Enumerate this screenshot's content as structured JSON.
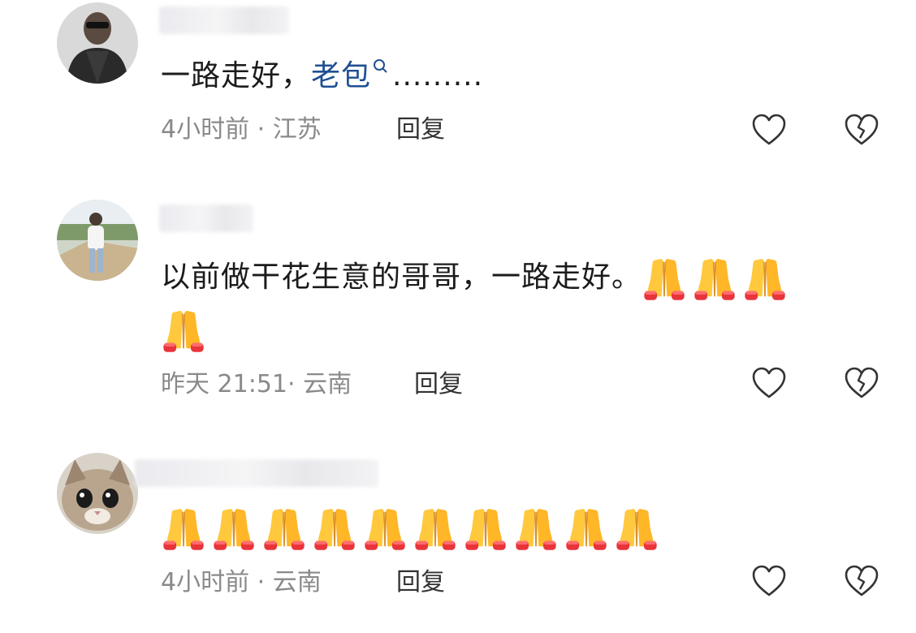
{
  "comments": [
    {
      "text_plain": "一路走好，",
      "link_text": "老包",
      "trailing": ".........",
      "time": "4小时前 · 江苏",
      "reply": "回复",
      "avatar": "user-photo-dark",
      "icons": [
        "heart-icon",
        "broken-heart-icon"
      ]
    },
    {
      "text": "以前做干花生意的哥哥，一路走好。",
      "emoji_count": 4,
      "emoji": "folded-hands",
      "time": "昨天 21:51· 云南",
      "reply": "回复",
      "avatar": "user-photo-outdoor",
      "icons": [
        "heart-icon",
        "broken-heart-icon"
      ]
    },
    {
      "emoji_count": 10,
      "emoji": "folded-hands",
      "time": "4小时前 · 云南",
      "reply": "回复",
      "avatar": "cat-photo",
      "icons": [
        "heart-icon",
        "broken-heart-icon"
      ]
    }
  ],
  "colors": {
    "link": "#1f4f92",
    "meta": "#8a8a8a",
    "icon": "#333333"
  }
}
